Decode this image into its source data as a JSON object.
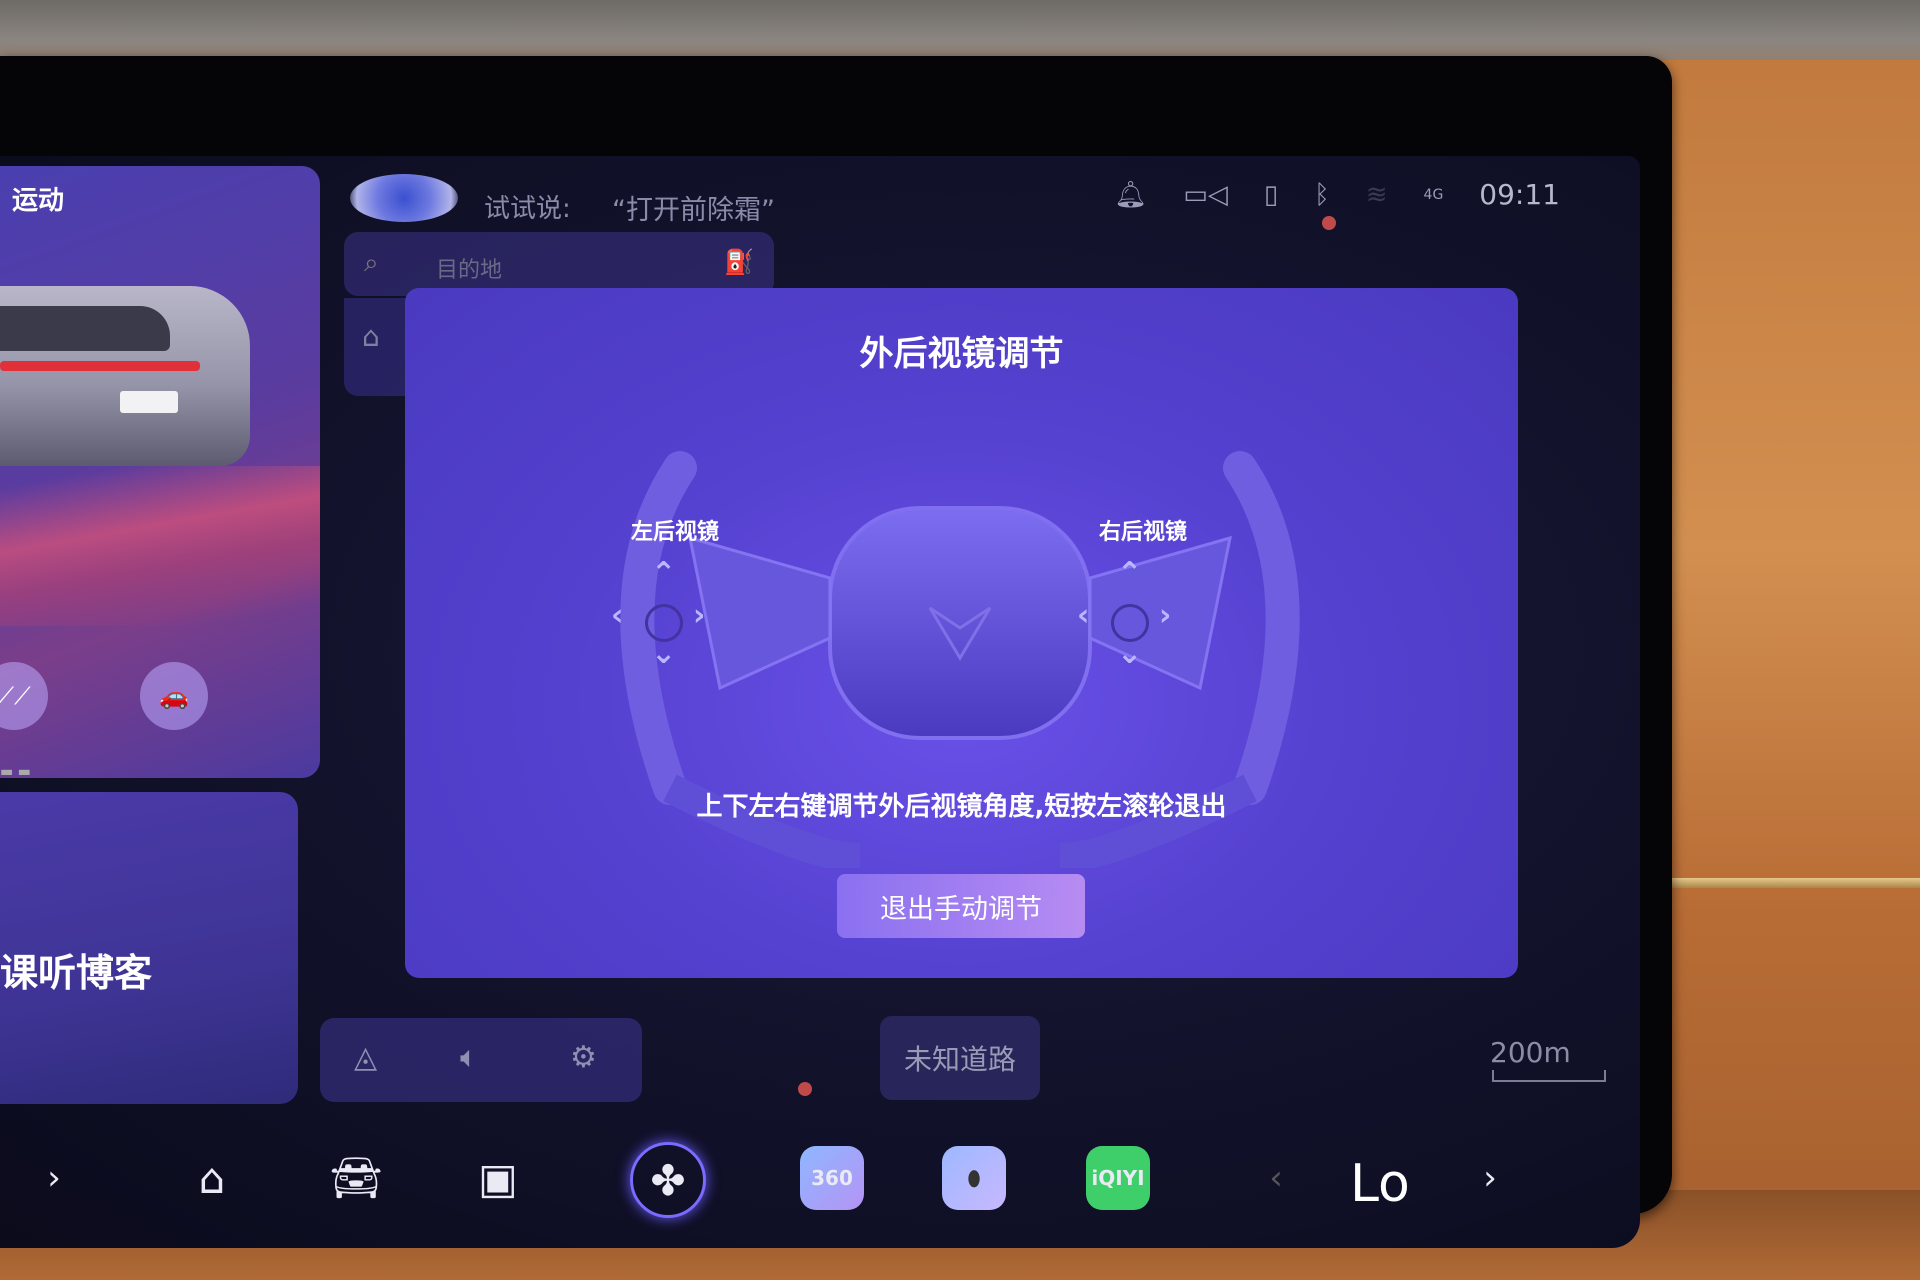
{
  "left_card": {
    "drive_mode": "运动",
    "plate_text": "",
    "podcast_label": "课听博客"
  },
  "voice": {
    "hint_prefix": "试试说:",
    "command": "“打开前除霜”"
  },
  "search": {
    "placeholder": "目的地"
  },
  "status_bar": {
    "signal_label": "4G",
    "time": "09:11"
  },
  "dialog": {
    "title": "外后视镜调节",
    "left_mirror_label": "左后视镜",
    "right_mirror_label": "右后视镜",
    "instruction": "上下左右键调节外后视镜角度,短按左滚轮退出",
    "exit_button": "退出手动调节"
  },
  "map": {
    "road_name": "未知道路",
    "scale": "200m"
  },
  "dock": {
    "app_360_label": "360",
    "app_iqiyi_label": "iQIYI",
    "temperature": "Lo"
  },
  "colors": {
    "dialog_bg": "#5441cf",
    "exit_button_start": "#8a70f0",
    "exit_button_end": "#b78cf2",
    "app_iqiyi": "#3ecf6a"
  }
}
